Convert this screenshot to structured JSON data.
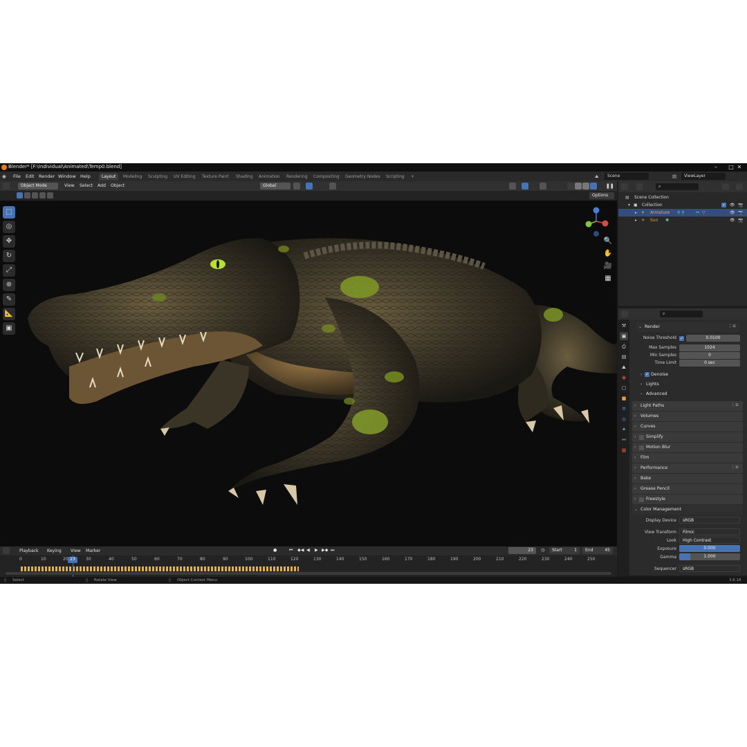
{
  "window": {
    "title": "Blender* [F:\\Individual\\Animated\\Temp0.blend]",
    "minimize": "–",
    "maximize": "□",
    "close": "✕"
  },
  "menu": [
    "File",
    "Edit",
    "Render",
    "Window",
    "Help"
  ],
  "workspaces": [
    "Layout",
    "Modeling",
    "Sculpting",
    "UV Editing",
    "Texture Paint",
    "Shading",
    "Animation",
    "Rendering",
    "Compositing",
    "Geometry Nodes",
    "Scripting"
  ],
  "workspace_add": "+",
  "active_workspace": "Layout",
  "scene": {
    "name": "Scene",
    "view_layer": "ViewLayer"
  },
  "viewport_header": {
    "mode": "Object Mode",
    "menus": [
      "View",
      "Select",
      "Add",
      "Object"
    ],
    "orientation": "Global",
    "options": "Options"
  },
  "toolbar_icons": [
    "select-box-icon",
    "cursor-icon",
    "move-icon",
    "rotate-icon",
    "scale-icon",
    "transform-icon",
    "annotate-icon",
    "measure-icon",
    "add-cube-icon"
  ],
  "outliner": {
    "rows": [
      {
        "label": "Scene Collection"
      },
      {
        "label": "Collection"
      },
      {
        "label": "Armature"
      },
      {
        "label": "Sun"
      }
    ]
  },
  "properties": {
    "panels": {
      "render": "Render",
      "light_paths": "Light Paths",
      "volumes": "Volumes",
      "curves": "Curves",
      "simplify": "Simplify",
      "motion_blur": "Motion Blur",
      "film": "Film",
      "performance": "Performance",
      "bake": "Bake",
      "grease_pencil": "Grease Pencil",
      "freestyle": "Freestyle",
      "color_management": "Color Management"
    },
    "subpanels": {
      "denoise": "Denoise",
      "lights": "Lights",
      "advanced": "Advanced"
    },
    "fields": {
      "noise_threshold_label": "Noise Threshold",
      "noise_threshold": "0.0100",
      "max_samples_label": "Max Samples",
      "max_samples": "1024",
      "min_samples_label": "Min Samples",
      "min_samples": "0",
      "time_limit_label": "Time Limit",
      "time_limit": "0 sec",
      "display_device_label": "Display Device",
      "display_device": "sRGB",
      "view_transform_label": "View Transform",
      "view_transform": "Filmic",
      "look_label": "Look",
      "look": "High Contrast",
      "exposure_label": "Exposure",
      "exposure": "0.000",
      "gamma_label": "Gamma",
      "gamma": "1.000",
      "sequencer_label": "Sequencer",
      "sequencer": "sRGB"
    }
  },
  "timeline": {
    "menus": [
      "Playback",
      "Keying",
      "View",
      "Marker"
    ],
    "current_frame": "23",
    "start_label": "Start",
    "start": "1",
    "end_label": "End",
    "end": "45",
    "ticks": [
      "0",
      "10",
      "20",
      "30",
      "40",
      "50",
      "60",
      "70",
      "80",
      "90",
      "100",
      "110",
      "120",
      "130",
      "140",
      "150",
      "160",
      "170",
      "180",
      "190",
      "200",
      "210",
      "220",
      "230",
      "240",
      "250"
    ]
  },
  "status": {
    "select": "Select",
    "rotate": "Rotate View",
    "context": "Object Context Menu",
    "version": "3.6.18"
  },
  "colors": {
    "accent": "#4772b3",
    "orange": "#e87d0d",
    "keyframe": "#e3b14a"
  }
}
